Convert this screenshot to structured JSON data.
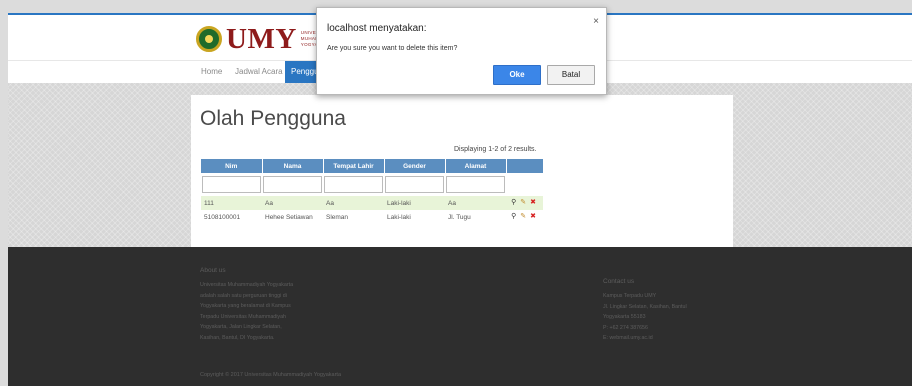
{
  "header": {
    "logo_text": "UMY",
    "logo_sub": [
      "UNIVERSITAS",
      "MUHAMMADIYAH",
      "YOGYAKARTA"
    ]
  },
  "nav": {
    "items": [
      "Home",
      "Jadwal Acara",
      "Pengguna"
    ],
    "active_index": 2
  },
  "page": {
    "title": "Olah Pengguna",
    "summary": "Displaying 1-2 of 2 results."
  },
  "table": {
    "headers": [
      "Nim",
      "Nama",
      "Tempat Lahir",
      "Gender",
      "Alamat",
      ""
    ],
    "rows": [
      [
        "111",
        "Aa",
        "Aa",
        "Laki-laki",
        "Aa"
      ],
      [
        "5108100001",
        "Hehee Setiawan",
        "Sleman",
        "Laki-laki",
        "Jl. Tugu"
      ]
    ],
    "actions": {
      "view": "⚲",
      "edit": "✎",
      "delete": "✖"
    }
  },
  "footer": {
    "about_title": "About us",
    "about_lines": [
      "Universitas Muhammadiyah Yogyakarta",
      "adalah salah satu perguruan tinggi di",
      "Yogyakarta yang beralamat di Kampus",
      "Terpadu Universitas Muhammadiyah",
      "Yogyakarta, Jalan Lingkar Selatan,",
      "Kasihan, Bantul, DI Yogyakarta."
    ],
    "contact_title": "Contact us",
    "contact_lines": [
      "Kampus Terpadu UMY",
      "Jl. Lingkar Selatan, Kasihan, Bantul",
      "Yogyakarta 55183",
      "P: +62 274 387656",
      "E: webmail.umy.ac.id"
    ],
    "copyright": "Copyright © 2017 Universitas Muhammadiyah Yogyakarta"
  },
  "dialog": {
    "title": "localhost menyatakan:",
    "message": "Are you sure you want to delete this item?",
    "ok_label": "Oke",
    "cancel_label": "Batal",
    "close_glyph": "×"
  },
  "colors": {
    "accent": "#2a76c2",
    "table_header": "#5b8ec0",
    "brand": "#8e1b1b",
    "footer_bg": "#2e2e2e"
  }
}
